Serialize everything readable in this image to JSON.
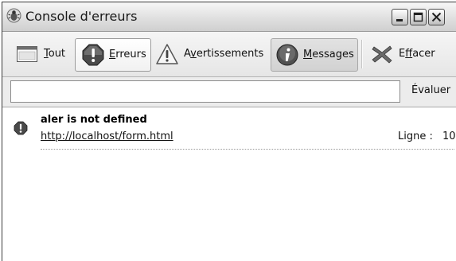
{
  "window": {
    "title": "Console d'erreurs"
  },
  "toolbar": {
    "all": {
      "prefix": "",
      "accel": "T",
      "rest": "out"
    },
    "errors": {
      "prefix": "",
      "accel": "E",
      "rest": "rreurs"
    },
    "warnings": {
      "prefix": "A",
      "accel": "v",
      "rest": "ertissements"
    },
    "messages": {
      "prefix": "",
      "accel": "M",
      "rest": "essages"
    },
    "clear": {
      "prefix": "E",
      "accel": "f",
      "rest": "facer"
    }
  },
  "eval": {
    "value": "",
    "button_label": "Évaluer"
  },
  "messages": [
    {
      "type": "error",
      "text": "aler is not defined",
      "source": "http://localhost/form.html",
      "line_label": "Ligne :",
      "line_number": "10"
    }
  ],
  "icons": {
    "app": "firebug-bug-icon",
    "all": "console-window-icon",
    "errors": "stop-sign-error-icon",
    "warnings": "warning-triangle-icon",
    "messages": "info-circle-icon",
    "clear": "clear-x-icon"
  }
}
